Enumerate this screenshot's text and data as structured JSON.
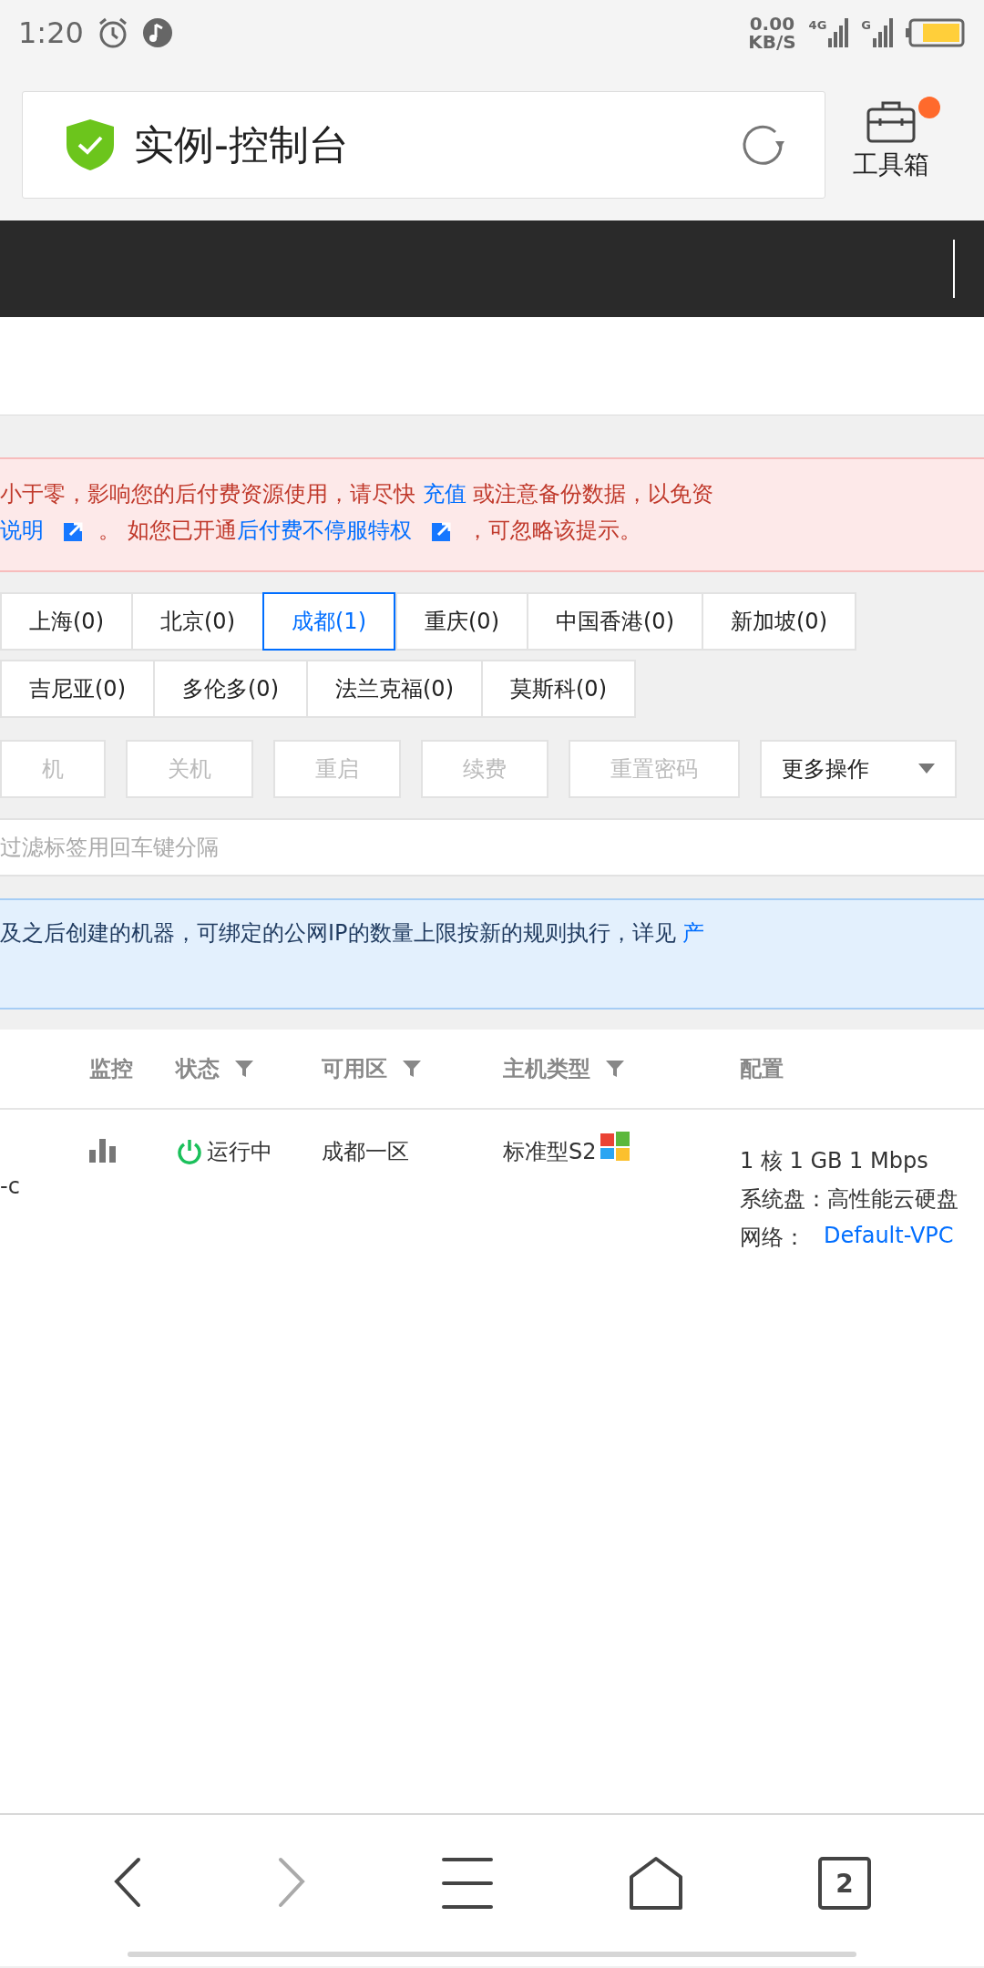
{
  "status_bar": {
    "time": "1:20",
    "speed_value": "0.00",
    "speed_unit": "KB/S",
    "network": "4G",
    "network2": "G"
  },
  "address_bar": {
    "title": "实例-控制台",
    "secure": true
  },
  "toolbox": {
    "label": "工具箱",
    "badge": true
  },
  "alert": {
    "lines": [
      [
        {
          "kind": "text",
          "text": "小于零，影响您的后付费资源使用，请尽快 "
        },
        {
          "kind": "link",
          "text": "充值"
        },
        {
          "kind": "text",
          "text": " 或注意备份数据，以免资"
        }
      ],
      [
        {
          "kind": "link",
          "text": "说明"
        },
        {
          "kind": "external"
        },
        {
          "kind": "text",
          "text": "。 如您已开通"
        },
        {
          "kind": "link",
          "text": "后付费不停服特权"
        },
        {
          "kind": "external"
        },
        {
          "kind": "text",
          "text": "，可忽略该提示。"
        }
      ]
    ]
  },
  "region_tabs": [
    [
      {
        "label": "上海(0)",
        "selected": false
      },
      {
        "label": "北京(0)",
        "selected": false
      },
      {
        "label": "成都(1)",
        "selected": true
      },
      {
        "label": "重庆(0)",
        "selected": false
      },
      {
        "label": "中国香港(0)",
        "selected": false
      },
      {
        "label": "新加坡(0)",
        "selected": false
      }
    ],
    [
      {
        "label": "吉尼亚(0)",
        "selected": false
      },
      {
        "label": "多伦多(0)",
        "selected": false
      },
      {
        "label": "法兰克福(0)",
        "selected": false
      },
      {
        "label": "莫斯科(0)",
        "selected": false
      }
    ]
  ],
  "actions": [
    {
      "label": "机",
      "disabled": true
    },
    {
      "label": "关机",
      "disabled": true
    },
    {
      "label": "重启",
      "disabled": true
    },
    {
      "label": "续费",
      "disabled": true
    },
    {
      "label": "重置密码",
      "disabled": true
    }
  ],
  "more_actions": {
    "label": "更多操作"
  },
  "filter": {
    "placeholder": "过滤标签用回车键分隔"
  },
  "info": {
    "text": "及之后创建的机器，可绑定的公网IP的数量上限按新的规则执行，详见 ",
    "link": "产"
  },
  "table": {
    "columns": [
      {
        "label": "监控",
        "filter": false
      },
      {
        "label": "状态",
        "filter": true
      },
      {
        "label": "可用区",
        "filter": true
      },
      {
        "label": "主机类型",
        "filter": true
      },
      {
        "label": "配置",
        "filter": false
      }
    ],
    "rows": [
      {
        "column_1": "-c",
        "status": "运行中",
        "running": true,
        "zone": "成都一区",
        "type": "标准型S2",
        "config": [
          "1 核 1 GB 1 Mbps",
          "系统盘：高性能云硬盘"
        ],
        "network_label": "网络：",
        "network": "Default-VPC"
      }
    ]
  },
  "nav": {
    "tabs_count": "2"
  }
}
